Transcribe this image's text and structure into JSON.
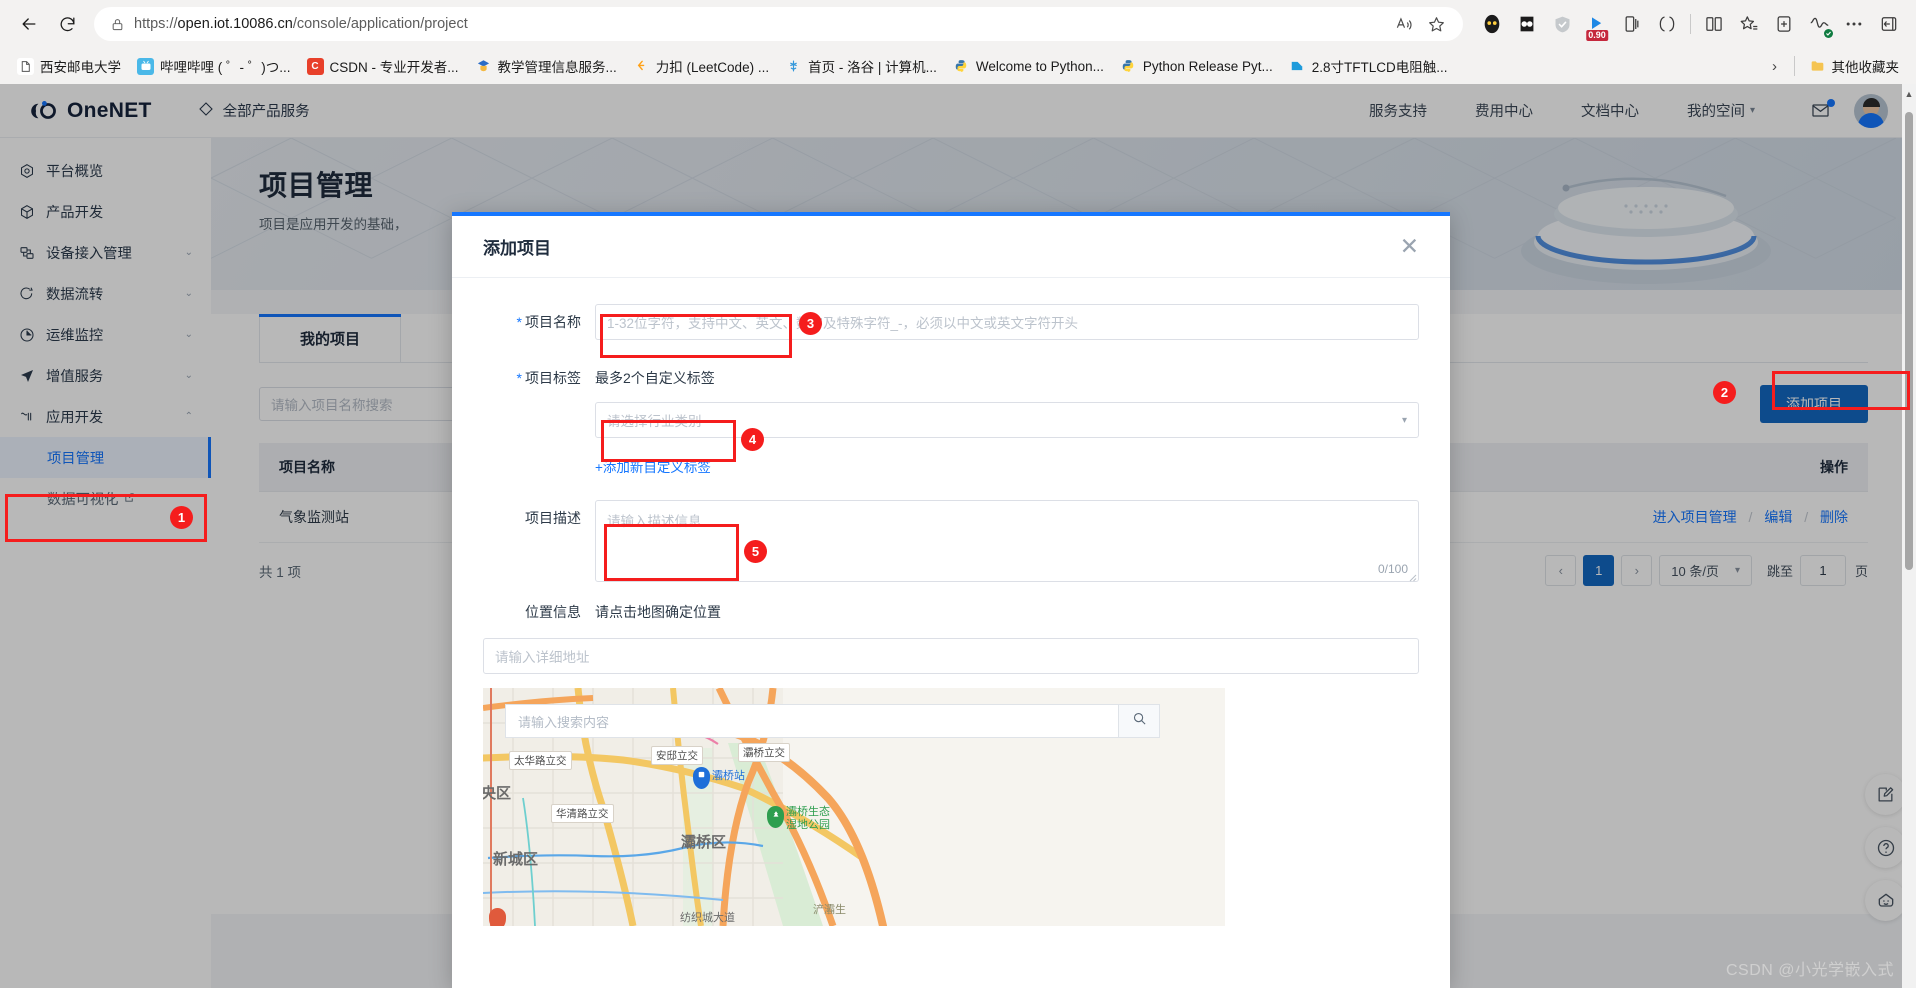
{
  "browser": {
    "url_prefix": "https://",
    "url_host": "open.iot.10086.cn",
    "url_path": "/console/application/project",
    "back_icon": "back-arrow-icon",
    "reload_icon": "reload-icon",
    "lock_icon": "lock-icon",
    "read_aloud_icon": "read-aloud-icon",
    "favorite_icon": "star-icon",
    "extensions": [
      {
        "name": "infinity-extension",
        "badge": ""
      },
      {
        "name": "dark-reader-extension",
        "badge": ""
      },
      {
        "name": "shield-extension",
        "badge": ""
      },
      {
        "name": "speed-extension",
        "badge": "0.90"
      },
      {
        "name": "collections-icon",
        "badge": ""
      },
      {
        "name": "browser-essentials-icon",
        "badge": ""
      },
      {
        "name": "split-screen-icon",
        "badge": ""
      },
      {
        "name": "favorites-icon",
        "badge": ""
      },
      {
        "name": "add-profile-icon",
        "badge": ""
      },
      {
        "name": "performance-icon",
        "badge": ""
      },
      {
        "name": "settings-more-icon",
        "badge": ""
      },
      {
        "name": "sidebar-toggle-icon",
        "badge": ""
      }
    ],
    "bookmarks": [
      {
        "label": "西安邮电大学",
        "fav_text": "",
        "fav_color": "#ffffff",
        "icon": "page-icon"
      },
      {
        "label": "哔哩哔哩 ( ゜- ゜)つ...",
        "fav_text": "",
        "fav_color": "#4ab8e8",
        "icon": "bilibili-icon"
      },
      {
        "label": "CSDN - 专业开发者...",
        "fav_text": "C",
        "fav_color": "#e8402a",
        "icon": "csdn-icon"
      },
      {
        "label": "教学管理信息服务...",
        "fav_text": "",
        "fav_color": "#2a6cc7",
        "icon": "school-icon"
      },
      {
        "label": "力扣 (LeetCode) ...",
        "fav_text": "",
        "fav_color": "#ffa116",
        "icon": "leetcode-icon"
      },
      {
        "label": "首页 - 洛谷 | 计算机...",
        "fav_text": "",
        "fav_color": "#3498db",
        "icon": "luogu-icon"
      },
      {
        "label": "Welcome to Python...",
        "fav_text": "",
        "fav_color": "#3776ab",
        "icon": "python-icon"
      },
      {
        "label": "Python Release Pyt...",
        "fav_text": "",
        "fav_color": "#3776ab",
        "icon": "python-icon"
      },
      {
        "label": "2.8寸TFTLCD电阻触...",
        "fav_text": "",
        "fav_color": "#1e9bdb",
        "icon": "doc-icon"
      }
    ],
    "bookmarks_overflow": "›",
    "other_favorites": "其他收藏夹"
  },
  "app_header": {
    "brand": "OneNET",
    "all_products": "全部产品服务",
    "nav": [
      {
        "label": "服务支持"
      },
      {
        "label": "费用中心"
      },
      {
        "label": "文档中心"
      },
      {
        "label": "我的空间",
        "caret": "▾"
      }
    ],
    "mail_icon": "mail-icon",
    "avatar_icon": "user-avatar"
  },
  "sidebar": {
    "items": [
      {
        "label": "平台概览",
        "icon": "overview-icon",
        "caret": ""
      },
      {
        "label": "产品开发",
        "icon": "product-icon",
        "caret": ""
      },
      {
        "label": "设备接入管理",
        "icon": "device-icon",
        "caret": "⌄"
      },
      {
        "label": "数据流转",
        "icon": "dataflow-icon",
        "caret": "⌄"
      },
      {
        "label": "运维监控",
        "icon": "monitor-icon",
        "caret": "⌄"
      },
      {
        "label": "增值服务",
        "icon": "valueadd-icon",
        "caret": "⌄"
      },
      {
        "label": "应用开发",
        "icon": "appdev-icon",
        "caret": "⌃"
      }
    ],
    "sub_items": [
      {
        "label": "项目管理",
        "active": true,
        "external": false
      },
      {
        "label": "数据可视化",
        "active": false,
        "external": true,
        "external_icon": "external-link-icon"
      }
    ]
  },
  "main": {
    "title": "项目管理",
    "subtitle": "项目是应用开发的基础，",
    "tabs": [
      {
        "label": "我的项目",
        "active": true
      }
    ],
    "search_placeholder": "请输入项目名称搜索",
    "add_button": "添加项目",
    "table": {
      "headers": [
        "项目名称",
        "操作"
      ],
      "rows": [
        {
          "name": "气象监测站",
          "actions": [
            "进入项目管理",
            "编辑",
            "删除"
          ],
          "separator": "/"
        }
      ]
    },
    "total_text": "共 1 项",
    "pagination": {
      "prev": "‹",
      "pages": [
        "1"
      ],
      "current": "1",
      "next": "›",
      "page_size": "10 条/页",
      "page_size_caret": "▾",
      "jump_label": "跳至",
      "jump_value": "1",
      "jump_suffix": "页"
    },
    "float_actions": [
      {
        "icon": "feedback-edit-icon"
      },
      {
        "icon": "help-question-icon"
      },
      {
        "icon": "smart-assistant-icon"
      }
    ]
  },
  "modal": {
    "title": "添加项目",
    "close_icon": "close-icon",
    "fields": {
      "name_label": "项目名称",
      "name_placeholder": "1-32位字符，支持中文、英文、数字及特殊字符_-，必须以中文或英文字符开头",
      "tag_label": "项目标签",
      "tag_hint": "最多2个自定义标签",
      "tag_select_placeholder": "请选择行业类别",
      "tag_select_caret": "▾",
      "add_tag_link": "+添加新自定义标签",
      "desc_label": "项目描述",
      "desc_placeholder": "请输入描述信息",
      "desc_counter": "0/100",
      "loc_label": "位置信息",
      "loc_hint": "请点击地图确定位置",
      "addr_placeholder": "请输入详细地址",
      "map_search_placeholder": "请输入搜索内容",
      "map_search_icon": "search-icon"
    },
    "map": {
      "districts": [
        "央区",
        "新城区",
        "灞桥区"
      ],
      "road_labels": [
        "太华路立交",
        "安邸立交",
        "灞桥立交",
        "华清路立交"
      ],
      "pois": [
        {
          "name": "灞桥站",
          "color": "#1e6fd9",
          "icon": "train-station-pin"
        },
        {
          "name": "灞桥生态\n湿地公园",
          "color": "#2e9e4f",
          "icon": "park-pin"
        }
      ],
      "edge_labels": [
        "浐灞生",
        "纺织城大道"
      ]
    }
  },
  "annotations": [
    {
      "number": "1",
      "target": "sidebar-item-project-management"
    },
    {
      "number": "2",
      "target": "add-project-button"
    },
    {
      "number": "3",
      "target": "project-name-input"
    },
    {
      "number": "4",
      "target": "industry-category-select"
    },
    {
      "number": "5",
      "target": "project-description-textarea"
    }
  ],
  "watermark": "CSDN @小光学嵌入式",
  "colors": {
    "accent": "#1677ff",
    "primary_button": "#1268c3",
    "annotation": "#f51d1d"
  }
}
